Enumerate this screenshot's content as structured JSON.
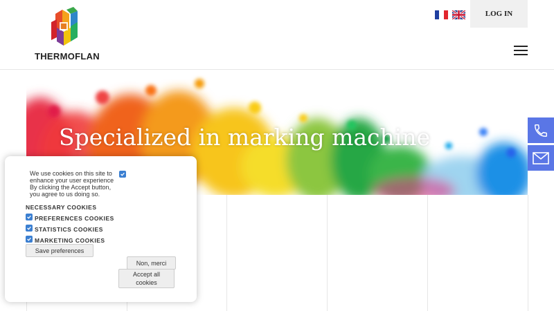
{
  "header": {
    "brand": "THERMOFLAN",
    "login_label": "LOG IN",
    "languages": [
      {
        "code": "fr",
        "icon": "french-flag-icon"
      },
      {
        "code": "en",
        "icon": "uk-flag-icon"
      }
    ],
    "menu_icon": "hamburger-menu-icon"
  },
  "hero": {
    "title": "Specialized in marking machine"
  },
  "side_actions": [
    {
      "icon": "phone-icon"
    },
    {
      "icon": "mail-icon"
    }
  ],
  "cookie_banner": {
    "intro": "We use cookies on this site to enhance your user experience By clicking the Accept button, you agree to us doing so.",
    "intro_checked": true,
    "categories": [
      {
        "label": "NECESSARY COOKIES",
        "checked": null
      },
      {
        "label": "PREFERENCES COOKIES",
        "checked": true
      },
      {
        "label": "STATISTICS COOKIES",
        "checked": true
      },
      {
        "label": "MARKETING COOKIES",
        "checked": true
      }
    ],
    "save_label": "Save preferences",
    "decline_label": "Non, merci",
    "accept_label": "Accept all cookies"
  },
  "colors": {
    "accent": "#5a76e6",
    "checkbox": "#3b7fd1",
    "login_bg": "#f0f0f0"
  }
}
